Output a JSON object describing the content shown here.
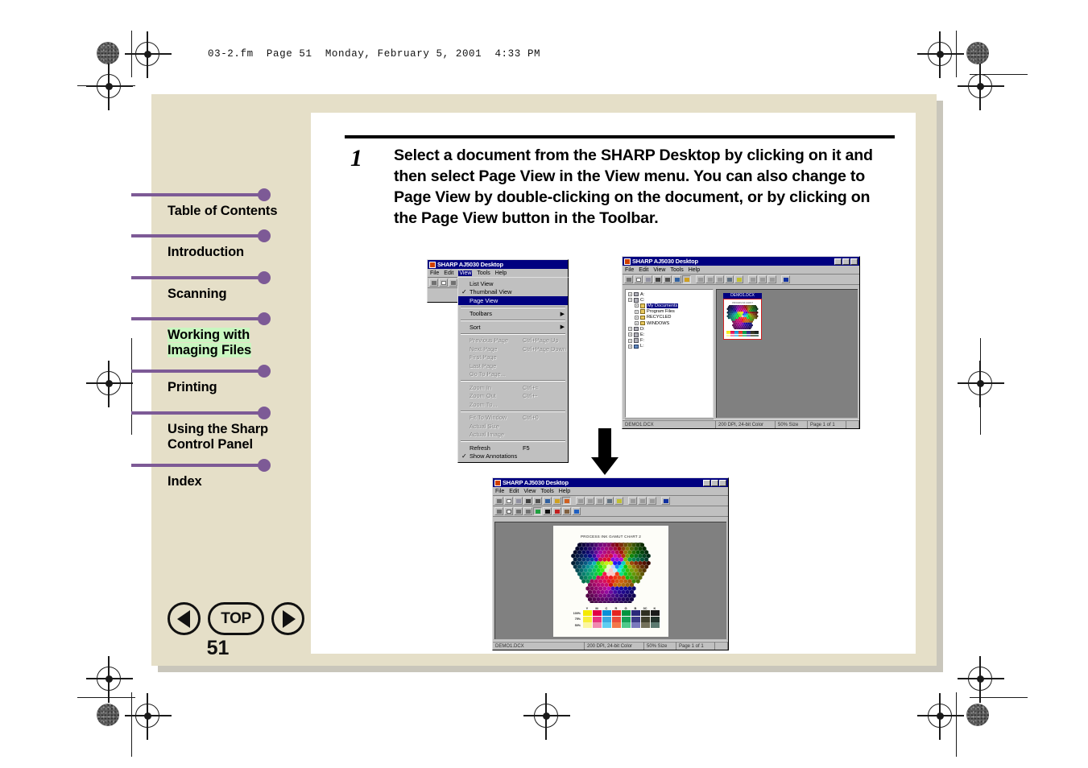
{
  "print_header": "03-2.fm  Page 51  Monday, February 5, 2001  4:33 PM",
  "colors": {
    "page_beige": "#e5dfc8",
    "accent_purple": "#7d5a96",
    "highlight_green": "#c9f7c0",
    "win_title_blue": "#000080",
    "win_face": "#c0c0c0"
  },
  "sidebar": {
    "items": [
      {
        "label": "Table of Contents",
        "highlighted": false
      },
      {
        "label": "Introduction",
        "highlighted": false
      },
      {
        "label": "Scanning",
        "highlighted": false
      },
      {
        "label": "Working with Imaging Files",
        "highlighted": true
      },
      {
        "label": "Printing",
        "highlighted": false
      },
      {
        "label": "Using the Sharp Control Panel",
        "highlighted": false
      },
      {
        "label": "Index",
        "highlighted": false
      }
    ],
    "nav": {
      "back_label": "Previous page",
      "top_label": "TOP",
      "forward_label": "Next page",
      "page_number": "51"
    }
  },
  "step": {
    "number": "1",
    "text": "Select a document from the SHARP Desktop by clicking on it and then select Page View in the View menu. You can also change to Page View by double-clicking on the document, or by clicking on the Page View button in the Toolbar."
  },
  "screenshot_menu": {
    "title": "SHARP AJ5030 Desktop",
    "menubar": [
      "File",
      "Edit",
      "View",
      "Tools",
      "Help"
    ],
    "open_menu": "View",
    "menu_items": [
      {
        "label": "List View",
        "accel": "",
        "checked": false,
        "disabled": false,
        "selected": false,
        "submenu": false
      },
      {
        "label": "Thumbnail View",
        "accel": "",
        "checked": true,
        "disabled": false,
        "selected": false,
        "submenu": false
      },
      {
        "label": "Page View",
        "accel": "",
        "checked": false,
        "disabled": false,
        "selected": true,
        "submenu": false
      },
      {
        "separator": true
      },
      {
        "label": "Toolbars",
        "accel": "",
        "checked": false,
        "disabled": false,
        "selected": false,
        "submenu": true
      },
      {
        "separator": true
      },
      {
        "label": "Sort",
        "accel": "",
        "checked": false,
        "disabled": false,
        "selected": false,
        "submenu": true
      },
      {
        "separator": true
      },
      {
        "label": "Previous Page",
        "accel": "Ctrl+Page Up",
        "checked": false,
        "disabled": true,
        "selected": false,
        "submenu": false
      },
      {
        "label": "Next Page",
        "accel": "Ctrl+Page Down",
        "checked": false,
        "disabled": true,
        "selected": false,
        "submenu": false
      },
      {
        "label": "First Page",
        "accel": "",
        "checked": false,
        "disabled": true,
        "selected": false,
        "submenu": false
      },
      {
        "label": "Last Page",
        "accel": "",
        "checked": false,
        "disabled": true,
        "selected": false,
        "submenu": false
      },
      {
        "label": "Go To Page...",
        "accel": "",
        "checked": false,
        "disabled": true,
        "selected": false,
        "submenu": false
      },
      {
        "separator": true
      },
      {
        "label": "Zoom In",
        "accel": "Ctrl+=",
        "checked": false,
        "disabled": true,
        "selected": false,
        "submenu": false
      },
      {
        "label": "Zoom Out",
        "accel": "Ctrl+-",
        "checked": false,
        "disabled": true,
        "selected": false,
        "submenu": false
      },
      {
        "label": "Zoom To...",
        "accel": "",
        "checked": false,
        "disabled": true,
        "selected": false,
        "submenu": false
      },
      {
        "separator": true
      },
      {
        "label": "Fit To Window",
        "accel": "Ctrl+0",
        "checked": false,
        "disabled": true,
        "selected": false,
        "submenu": false
      },
      {
        "label": "Actual Size",
        "accel": "",
        "checked": false,
        "disabled": true,
        "selected": false,
        "submenu": false
      },
      {
        "label": "Actual Image",
        "accel": "",
        "checked": false,
        "disabled": true,
        "selected": false,
        "submenu": false
      },
      {
        "separator": true
      },
      {
        "label": "Refresh",
        "accel": "F5",
        "checked": false,
        "disabled": false,
        "selected": false,
        "submenu": false
      },
      {
        "label": "Show Annotations",
        "accel": "",
        "checked": true,
        "disabled": false,
        "selected": false,
        "submenu": false
      }
    ]
  },
  "screenshot_desktop": {
    "title": "SHARP AJ5030 Desktop",
    "menubar": [
      "File",
      "Edit",
      "View",
      "Tools",
      "Help"
    ],
    "tree": [
      {
        "label": "A:",
        "indent": 0,
        "icon": "drive",
        "expandable": true,
        "selected": false
      },
      {
        "label": "C:",
        "indent": 0,
        "icon": "drive",
        "expandable": true,
        "selected": false
      },
      {
        "label": "My Documents",
        "indent": 1,
        "icon": "folder",
        "expandable": true,
        "selected": true
      },
      {
        "label": "Program Files",
        "indent": 1,
        "icon": "folder",
        "expandable": true,
        "selected": false
      },
      {
        "label": "RECYCLED",
        "indent": 1,
        "icon": "folder",
        "expandable": true,
        "selected": false
      },
      {
        "label": "WINDOWS",
        "indent": 1,
        "icon": "folder",
        "expandable": true,
        "selected": false
      },
      {
        "label": "D:",
        "indent": 0,
        "icon": "drive",
        "expandable": true,
        "selected": false
      },
      {
        "label": "E:",
        "indent": 0,
        "icon": "drive",
        "expandable": true,
        "selected": false
      },
      {
        "label": "F:",
        "indent": 0,
        "icon": "drive",
        "expandable": true,
        "selected": false
      },
      {
        "label": "L:",
        "indent": 0,
        "icon": "network",
        "expandable": true,
        "selected": false
      }
    ],
    "document": {
      "caption": "DEMO1.DCX",
      "selected": true
    },
    "status": {
      "left": "DEMO1.DCX",
      "resolution": "200 DPI, 24-bit Color",
      "zoom": "50% Size",
      "page": "Page 1 of 1"
    }
  },
  "screenshot_pageview": {
    "title": "SHARP AJ5030 Desktop",
    "menubar": [
      "File",
      "Edit",
      "View",
      "Tools",
      "Help"
    ],
    "document": {
      "title": "PROCESS INK GAMUT CHART 2",
      "swatch_columns": [
        "Y",
        "M",
        "C",
        "R",
        "G",
        "B",
        "3C",
        "K"
      ],
      "swatch_rows": [
        "100%",
        "75%",
        "50%"
      ],
      "swatch_colors": [
        [
          "#f5ea00",
          "#e30045",
          "#0a8fd8",
          "#e52520",
          "#00953f",
          "#2b2a7a",
          "#2f2f20",
          "#1a1a1a"
        ],
        [
          "#f8ef3a",
          "#e8357e",
          "#3aa9e0",
          "#ea4a3a",
          "#14a055",
          "#3b3a87",
          "#3f3f2c",
          "#23332c"
        ],
        [
          "#fbf6a0",
          "#f08ab0",
          "#5fcdf0",
          "#f2784a",
          "#4fc98a",
          "#7a79bd",
          "#73715a",
          "#5c7a70"
        ]
      ]
    },
    "status": {
      "left": "DEMO1.DCX",
      "resolution": "200 DPI, 24-bit Color",
      "zoom": "50% Size",
      "page": "Page 1 of 1"
    }
  },
  "flow_arrow": {
    "direction": "down"
  }
}
